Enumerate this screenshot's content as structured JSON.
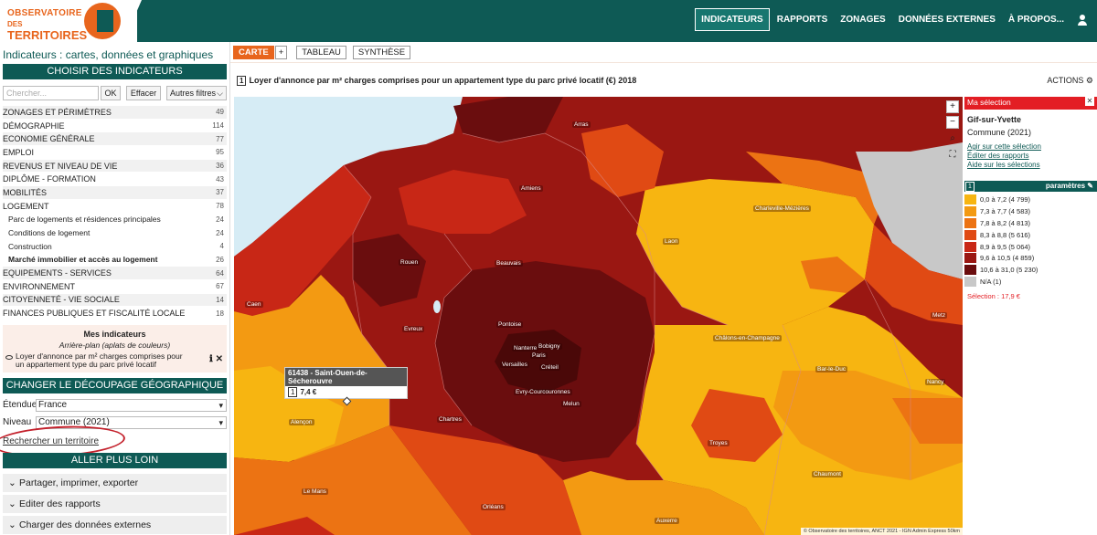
{
  "header": {
    "logo": {
      "line1": "OBSERVATOIRE",
      "line2": "DES",
      "line3": "TERRITOIRES"
    },
    "nav": [
      "INDICATEURS",
      "RAPPORTS",
      "ZONAGES",
      "DONNÉES EXTERNES",
      "À PROPOS..."
    ],
    "nav_active": "INDICATEURS",
    "user_icon": "user-icon"
  },
  "sidebar": {
    "title": "Indicateurs : cartes, données et graphiques",
    "choose_header": "CHOISIR DES INDICATEURS",
    "search_placeholder": "Chercher...",
    "ok_label": "OK",
    "clear_label": "Effacer",
    "filters_label": "Autres filtres",
    "categories": [
      {
        "label": "ZONAGES ET PÉRIMÈTRES",
        "count": "49"
      },
      {
        "label": "DÉMOGRAPHIE",
        "count": "114"
      },
      {
        "label": "ECONOMIE GÉNÉRALE",
        "count": "77"
      },
      {
        "label": "EMPLOI",
        "count": "95"
      },
      {
        "label": "REVENUS ET NIVEAU DE VIE",
        "count": "36"
      },
      {
        "label": "DIPLÔME - FORMATION",
        "count": "43"
      },
      {
        "label": "MOBILITÉS",
        "count": "37"
      },
      {
        "label": "LOGEMENT",
        "count": "78"
      },
      {
        "label": "Parc de logements et résidences principales",
        "count": "24"
      },
      {
        "label": "Conditions de logement",
        "count": "24"
      },
      {
        "label": "Construction",
        "count": "4"
      },
      {
        "label": "Marché immobilier et accès au logement",
        "count": "26"
      },
      {
        "label": "EQUIPEMENTS - SERVICES",
        "count": "64"
      },
      {
        "label": "ENVIRONNEMENT",
        "count": "67"
      },
      {
        "label": "CITOYENNETÉ - VIE SOCIALE",
        "count": "14"
      },
      {
        "label": "FINANCES PUBLIQUES ET FISCALITÉ LOCALE",
        "count": "18"
      }
    ],
    "my_indicators": {
      "title": "Mes indicateurs",
      "subtitle": "Arrière-plan (aplats de couleurs)",
      "indicator": "Loyer d'annonce par m² charges comprises pour un appartement type du parc privé locatif"
    },
    "geo_header": "CHANGER LE DÉCOUPAGE GÉOGRAPHIQUE",
    "scope_label": "Étendue",
    "scope_value": "France",
    "level_label": "Niveau",
    "level_value": "Commune (2021)",
    "search_territory": "Rechercher un territoire",
    "further_header": "ALLER PLUS LOIN",
    "accordions": [
      "Partager, imprimer, exporter",
      "Editer des rapports",
      "Charger des données externes"
    ]
  },
  "main": {
    "tabs": [
      "CARTE",
      "+",
      "TABLEAU",
      "SYNTHÈSE"
    ],
    "active_tab": "CARTE",
    "indicator_number": "1",
    "map_title": "Loyer d'annonce par m² charges comprises pour un appartement type du parc privé locatif (€) 2018",
    "actions_label": "ACTIONS",
    "map_controls": [
      "plus-icon",
      "minus-icon",
      "search-icon",
      "fullscreen-icon"
    ],
    "tooltip": {
      "title": "61438 - Saint-Ouen-de-Sécherouvre",
      "number": "1",
      "value": "7,4 €"
    },
    "cities": [
      "Arras",
      "Amiens",
      "Charleville-Mézières",
      "Laon",
      "Rouen",
      "Beauvais",
      "Caen",
      "Evreux",
      "Pontoise",
      "Nanterre",
      "Bobigny",
      "Paris",
      "Versailles",
      "Créteil",
      "Evry-Courcouronnes",
      "Melun",
      "Châlons-en-Champagne",
      "Bar-le-Duc",
      "Metz",
      "Nancy",
      "Alençon",
      "Chartres",
      "Troyes",
      "Chaumont",
      "Le Mans",
      "Orléans",
      "Auxerre"
    ],
    "credit": "© Observatoire des territoires, ANCT 2021 - IGN Admin Express   50km"
  },
  "selection": {
    "header": "Ma sélection",
    "name": "Gif-sur-Yvette",
    "type": "Commune (2021)",
    "links": [
      "Agir sur cette sélection",
      "Éditer des rapports",
      "Aide sur les sélections"
    ]
  },
  "legend": {
    "number": "1",
    "params_label": "paramètres",
    "items": [
      {
        "label": "0,0 à 7,2 (4 799)",
        "color": "#f7b511"
      },
      {
        "label": "7,3 à 7,7 (4 583)",
        "color": "#f39a12"
      },
      {
        "label": "7,8 à 8,2 (4 813)",
        "color": "#ec7313"
      },
      {
        "label": "8,3 à 8,8 (5 616)",
        "color": "#e04a14"
      },
      {
        "label": "8,9 à 9,5 (5 064)",
        "color": "#c82716"
      },
      {
        "label": "9,6 à 10,5 (4 859)",
        "color": "#9a1712"
      },
      {
        "label": "10,6 à 31,0 (5 230)",
        "color": "#6a0d0e"
      },
      {
        "label": "N/A (1)",
        "color": "#c8c8c8"
      }
    ],
    "selection_value": "Sélection : 17,9 €"
  }
}
